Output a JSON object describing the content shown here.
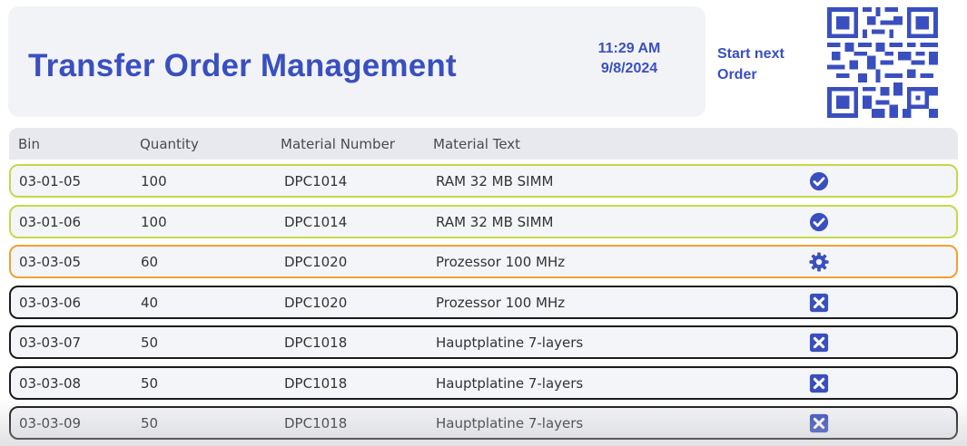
{
  "header": {
    "title": "Transfer Order Management",
    "time": "11:29 AM",
    "date": "9/8/2024",
    "start_next_line1": "Start next",
    "start_next_line2": "Order",
    "qr_icon": "qr-code"
  },
  "table": {
    "columns": {
      "bin": "Bin",
      "quantity": "Quantity",
      "material_number": "Material Number",
      "material_text": "Material Text"
    },
    "rows": [
      {
        "bin": "03-01-05",
        "quantity": "100",
        "material_number": "DPC1014",
        "material_text": "RAM 32 MB  SIMM",
        "status": "done",
        "icon": "check-circle-icon"
      },
      {
        "bin": "03-01-06",
        "quantity": "100",
        "material_number": "DPC1014",
        "material_text": "RAM 32 MB  SIMM",
        "status": "done",
        "icon": "check-circle-icon"
      },
      {
        "bin": "03-03-05",
        "quantity": "60",
        "material_number": "DPC1020",
        "material_text": "Prozessor  100 MHz",
        "status": "active",
        "icon": "gear-icon"
      },
      {
        "bin": "03-03-06",
        "quantity": "40",
        "material_number": "DPC1020",
        "material_text": "Prozessor  100 MHz",
        "status": "pending",
        "icon": "close-box-icon"
      },
      {
        "bin": "03-03-07",
        "quantity": "50",
        "material_number": "DPC1018",
        "material_text": "Hauptplatine 7-layers",
        "status": "pending",
        "icon": "close-box-icon"
      },
      {
        "bin": "03-03-08",
        "quantity": "50",
        "material_number": "DPC1018",
        "material_text": "Hauptplatine 7-layers",
        "status": "pending",
        "icon": "close-box-icon"
      },
      {
        "bin": "03-03-09",
        "quantity": "50",
        "material_number": "DPC1018",
        "material_text": "Hauptplatine 7-layers",
        "status": "pending",
        "icon": "close-box-icon"
      }
    ]
  },
  "colors": {
    "accent": "#3a4fbf",
    "done_border": "#c6d84a",
    "active_border": "#f0a030",
    "pending_border": "#1b1b1b"
  }
}
